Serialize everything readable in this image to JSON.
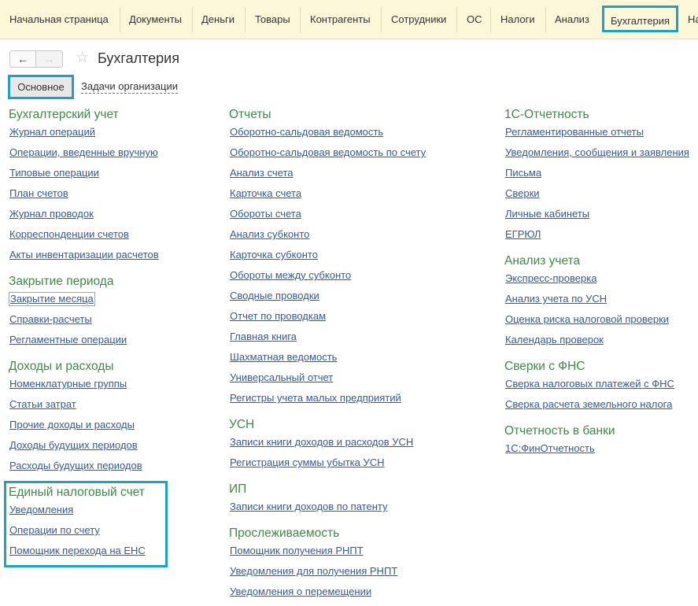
{
  "topbar": {
    "tabs": [
      "Начальная страница",
      "Документы",
      "Деньги",
      "Товары",
      "Контрагенты",
      "Сотрудники",
      "ОС",
      "Налоги",
      "Анализ",
      "Бухгалтерия",
      "На"
    ],
    "active_tab": "Бухгалтерия"
  },
  "nav": {
    "back_icon": "←",
    "forward_icon": "→",
    "star_icon": "☆"
  },
  "page": {
    "title": "Бухгалтерия"
  },
  "subtabs": {
    "main": "Основное",
    "tasks": "Задачи организации"
  },
  "col1": {
    "s1": {
      "title": "Бухгалтерский учет",
      "links": [
        "Журнал операций",
        "Операции, введенные вручную",
        "Типовые операции",
        "План счетов",
        "Журнал проводок",
        "Корреспонденции счетов",
        "Акты инвентаризации расчетов"
      ]
    },
    "s2": {
      "title": "Закрытие периода",
      "links": [
        "Закрытие месяца",
        "Справки-расчеты",
        "Регламентные операции"
      ]
    },
    "s3": {
      "title": "Доходы и расходы",
      "links": [
        "Номенклатурные группы",
        "Статьи затрат",
        "Прочие доходы и расходы",
        "Доходы будущих периодов",
        "Расходы будущих периодов"
      ]
    },
    "s4": {
      "title": "Единый налоговый счет",
      "links": [
        "Уведомления",
        "Операции по счету",
        "Помощник перехода на ЕНС"
      ]
    }
  },
  "col2": {
    "s1": {
      "title": "Отчеты",
      "links": [
        "Оборотно-сальдовая ведомость",
        "Оборотно-сальдовая ведомость по счету",
        "Анализ счета",
        "Карточка счета",
        "Обороты счета",
        "Анализ субконто",
        "Карточка субконто",
        "Обороты между субконто",
        "Сводные проводки",
        "Отчет по проводкам",
        "Главная книга",
        "Шахматная ведомость",
        "Универсальный отчет",
        "Регистры учета малых предприятий"
      ]
    },
    "s2": {
      "title": "УСН",
      "links": [
        "Записи книги доходов и расходов УСН",
        "Регистрация суммы убытка УСН"
      ]
    },
    "s3": {
      "title": "ИП",
      "links": [
        "Записи книги доходов по патенту"
      ]
    },
    "s4": {
      "title": "Прослеживаемость",
      "links": [
        "Помощник получения РНПТ",
        "Уведомления для получения РНПТ",
        "Уведомления о перемещении"
      ]
    }
  },
  "col3": {
    "s1": {
      "title": "1С-Отчетность",
      "links": [
        "Регламентированные отчеты",
        "Уведомления, сообщения и заявления",
        "Письма",
        "Сверки",
        "Личные кабинеты",
        "ЕГРЮЛ"
      ]
    },
    "s2": {
      "title": "Анализ учета",
      "links": [
        "Экспресс-проверка",
        "Анализ учета по УСН",
        "Оценка риска налоговой проверки",
        "Календарь проверок"
      ]
    },
    "s3": {
      "title": "Сверки с ФНС",
      "links": [
        "Сверка налоговых платежей с ФНС",
        "Сверка расчета земельного налога"
      ]
    },
    "s4": {
      "title": "Отчетность в банки",
      "links": [
        "1С:ФинОтчетность"
      ]
    }
  },
  "colors": {
    "accent": "#1ea1c2",
    "section": "#3d8a44",
    "link": "#2f5b9c",
    "topbar_bg": "#fbf7d8"
  }
}
